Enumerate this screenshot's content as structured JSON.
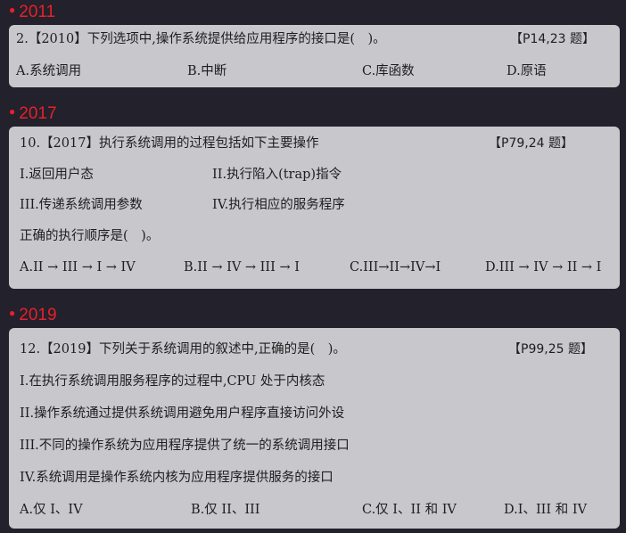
{
  "sections": [
    {
      "year": "2011",
      "question": {
        "stem": "2.【2010】下列选项中,操作系统提供给应用程序的接口是(　)。",
        "ref": "【P14,23 题】",
        "options": [
          "A.系统调用",
          "B.中断",
          "C.库函数",
          "D.原语"
        ]
      }
    },
    {
      "year": "2017",
      "question": {
        "stem": "10.【2017】执行系统调用的过程包括如下主要操作",
        "ref": "【P79,24 题】",
        "items": [
          "I.返回用户态",
          "II.执行陷入(trap)指令",
          "III.传递系统调用参数",
          "IV.执行相应的服务程序"
        ],
        "prompt": "正确的执行顺序是(　)。",
        "options": [
          "A.II → III → I → IV",
          "B.II → IV → III → I",
          "C.III→II→IV→I",
          "D.III → IV → II → I"
        ]
      }
    },
    {
      "year": "2019",
      "question": {
        "stem": "12.【2019】下列关于系统调用的叙述中,正确的是(　)。",
        "ref": "【P99,25 题】",
        "items": [
          "I.在执行系统调用服务程序的过程中,CPU 处于内核态",
          "II.操作系统通过提供系统调用避免用户程序直接访问外设",
          "III.不同的操作系统为应用程序提供了统一的系统调用接口",
          "IV.系统调用是操作系统内核为应用程序提供服务的接口"
        ],
        "options": [
          "A.仅 I、IV",
          "B.仅 II、III",
          "C.仅 I、II 和 IV",
          "D.I、III 和 IV"
        ]
      }
    }
  ]
}
